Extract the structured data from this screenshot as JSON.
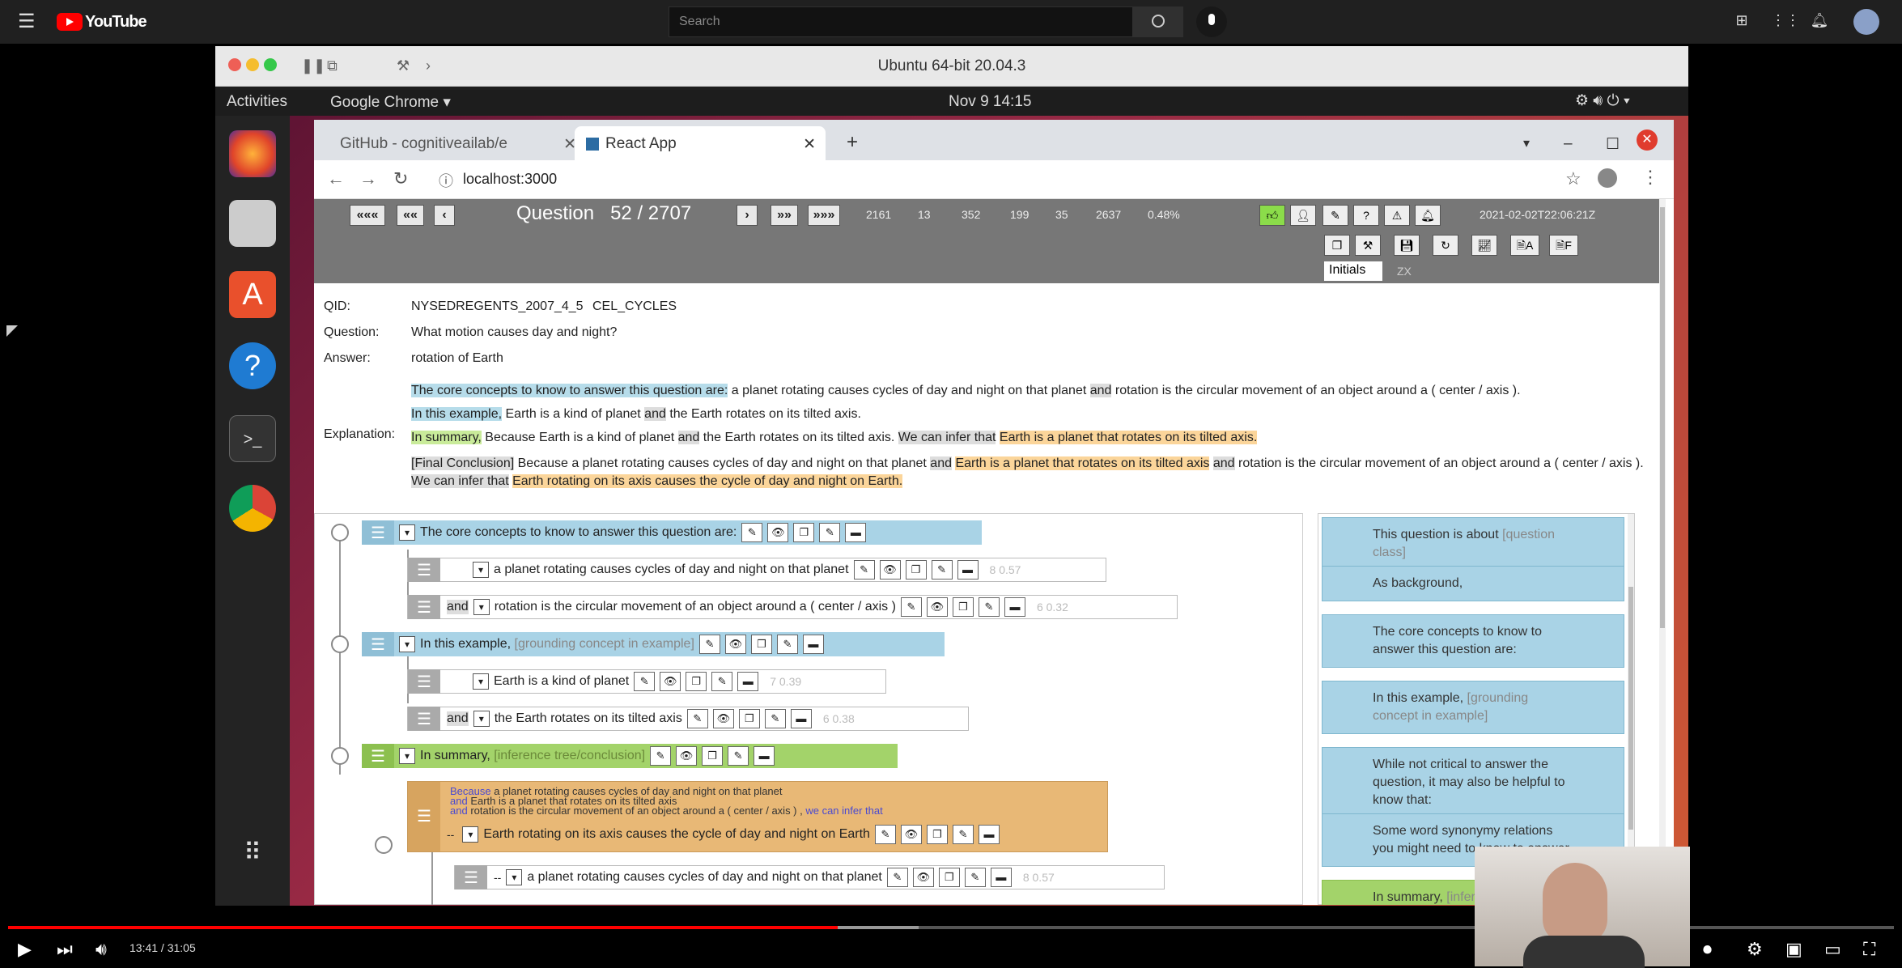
{
  "youtube": {
    "logo": "YouTube",
    "search_placeholder": "Search",
    "time": "13:41 / 31:05",
    "progress_fraction": 0.44
  },
  "vm": {
    "title": "Ubuntu 64-bit 20.04.3"
  },
  "gnome": {
    "activities": "Activities",
    "app": "Google Chrome ▾",
    "clock": "Nov 9  14:15"
  },
  "chrome": {
    "tabs": [
      "GitHub - cognitiveailab/e",
      {
        "label": "React App"
      }
    ],
    "url": "localhost:3000"
  },
  "app": {
    "nav": {
      "first": "«««",
      "prev10": "««",
      "prev": "‹",
      "next": "›",
      "next10": "»»",
      "last": "»»»"
    },
    "question_label": "Question",
    "question_pos": "52 / 2707",
    "stats": [
      "2161",
      "13",
      "352",
      "199",
      "35",
      "2637",
      "0.48%"
    ],
    "timestamp": "2021-02-02T22:06:21Z",
    "initials_label": "Initials",
    "initials_value": "ZX",
    "qid_label": "QID:",
    "qid": "NYSEDREGENTS_2007_4_5",
    "topic": "CEL_CYCLES",
    "question_field_label": "Question:",
    "question": "What motion causes day and night?",
    "answer_label": "Answer:",
    "answer": "rotation of Earth",
    "explanation_label": "Explanation:",
    "exp1a": "The core concepts to know to answer this question are:",
    "exp1b": " a planet rotating causes cycles of day and night on that planet ",
    "exp1c": "and",
    "exp1d": " rotation is the circular movement of an object around a ( center / axis ).",
    "exp2a": "In this example,",
    "exp2b": " Earth is a kind of planet ",
    "exp2c": "and",
    "exp2d": " the Earth rotates on its tilted axis.",
    "exp3a": "In summary,",
    "exp3b": " Because Earth is a kind of planet ",
    "exp3c": "and",
    "exp3d": " the Earth rotates on its tilted axis. ",
    "exp3e": "We can infer that",
    "exp3f": "Earth is a planet that rotates on its tilted axis.",
    "exp4a": "[Final Conclusion]",
    "exp4b": " Because a planet rotating causes cycles of day and night on that planet ",
    "exp4c": "and",
    "exp4d": "Earth is a planet that rotates on its tilted axis",
    "exp4e": "and",
    "exp4f": " rotation is the circular movement of an object around a ( center / axis ).",
    "exp4g": "We can infer that",
    "exp4h": "Earth rotating on its axis causes the cycle of day and night on Earth."
  },
  "tree": {
    "r1": "The core concepts to know to answer this question are:",
    "r2": "a planet rotating causes cycles of day and night on that planet",
    "r2s": "8   0.57",
    "r3and": "and",
    "r3": "rotation is the circular movement of an object around a ( center / axis )",
    "r3s": "6   0.32",
    "r4": "In this example,",
    "r4g": "[grounding concept in example]",
    "r5": "Earth is a kind of planet",
    "r5s": "7   0.39",
    "r6and": "and",
    "r6": "the Earth rotates on its tilted axis",
    "r6s": "6   0.38",
    "r7": "In summary,",
    "r7g": "[inference tree/conclusion]",
    "r8a": "Because",
    "r8b": " a planet rotating causes cycles of day and night on that planet",
    "r8c": "and",
    "r8d": " Earth is a planet that rotates on its tilted axis",
    "r8e": "and",
    "r8f": " rotation is the circular movement of an object around a ( center / axis ) , ",
    "r8g": "we can infer that",
    "r8h": "Earth rotating on its axis causes the cycle of day and night on Earth",
    "r9": "a planet rotating causes cycles of day and night on that planet",
    "r9s": "8   0.57"
  },
  "side": {
    "c1": "This question is about ",
    "c1g": "[question class]",
    "c2": "As background,",
    "c3": "The core concepts to know to answer this question are:",
    "c4": "In this example, ",
    "c4g": "[grounding concept in example]",
    "c5": "While not critical to answer the question, it may also be helpful to know that:",
    "c6": "Some word synonymy relations you might need to know to answer",
    "c7": "In summary, ",
    "c7g": "[inference]"
  }
}
